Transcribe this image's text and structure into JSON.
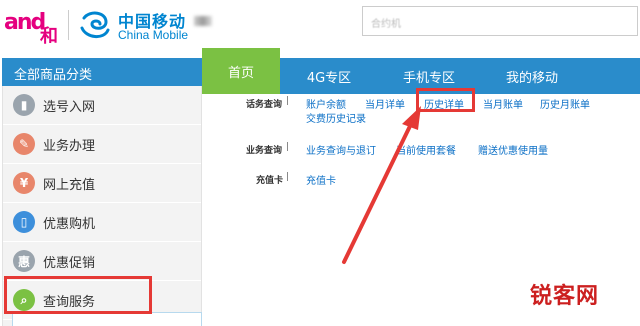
{
  "header": {
    "and_logo_text": "and",
    "and_logo_he": "和",
    "cm_name_cn": "中国移动",
    "cm_name_en": "China Mobile",
    "search_placeholder": "合约机"
  },
  "left_menu": {
    "title": "全部商品分类",
    "items": [
      {
        "label": "选号入网",
        "icon": "sim-card-icon",
        "color": "#9aa4ad"
      },
      {
        "label": "业务办理",
        "icon": "pencil-icon",
        "color": "#e8866b"
      },
      {
        "label": "网上充值",
        "icon": "yuan-icon",
        "color": "#e8866b"
      },
      {
        "label": "优惠购机",
        "icon": "phone-icon",
        "color": "#3d8fdb"
      },
      {
        "label": "优惠促销",
        "icon": "hui-icon",
        "color": "#9aa4ad"
      },
      {
        "label": "查询服务",
        "icon": "magnifier-icon",
        "color": "#7bc143"
      }
    ]
  },
  "nav": {
    "tabs": [
      {
        "label": "首页",
        "active": true
      },
      {
        "label": "4G专区",
        "active": false
      },
      {
        "label": "手机专区",
        "active": false
      },
      {
        "label": "我的移动",
        "active": false
      }
    ]
  },
  "sub_menu": {
    "rows": [
      {
        "label": "话务查询",
        "separator": "|",
        "links": [
          "账户余额",
          "当月详单",
          "历史详单",
          "当月账单",
          "历史月账单",
          "交费历史记录"
        ]
      },
      {
        "label": "业务查询",
        "separator": "|",
        "links": [
          "业务查询与退订",
          "当前使用套餐",
          "赠送优惠使用量"
        ]
      },
      {
        "label": "充值卡",
        "separator": "|",
        "links": [
          "充值卡"
        ]
      }
    ]
  },
  "watermark": "锐客网",
  "colors": {
    "brand_blue": "#2a8ccb",
    "active_green": "#7bc143",
    "link_blue": "#0b6fc6",
    "annotation_red": "#e53935"
  }
}
